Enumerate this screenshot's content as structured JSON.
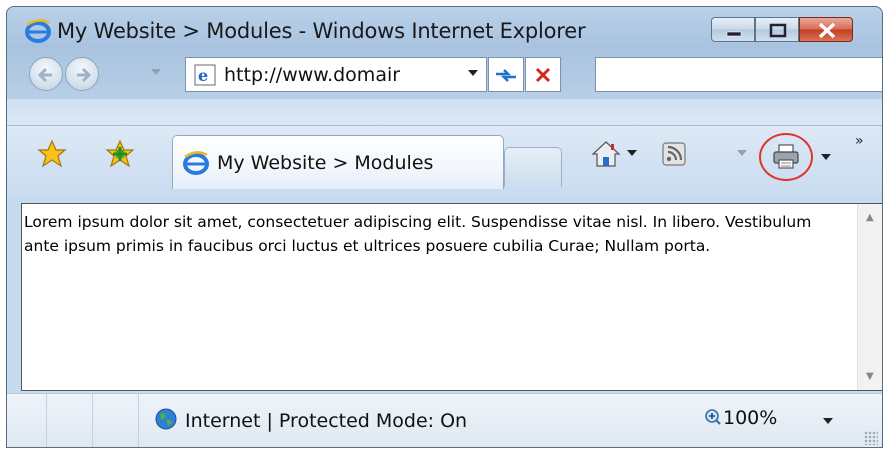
{
  "window": {
    "title": "My Website > Modules - Windows Internet Explorer"
  },
  "address_bar": {
    "url": "http://www.domair"
  },
  "tabs": [
    {
      "label": "My Website > Modules",
      "active": true
    }
  ],
  "content": {
    "text": "Lorem ipsum dolor sit amet, consectetuer adipiscing elit. Suspendisse vitae nisl. In libero. Vestibulum ante ipsum primis in faucibus orci luctus et ultrices posuere cubilia Curae; Nullam porta."
  },
  "status_bar": {
    "zone_text": "Internet | Protected Mode: On",
    "zoom": "100%"
  },
  "toolbar": {
    "overflow_glyph": "»"
  },
  "icons": {
    "title": "ie-logo-icon",
    "back": "back-arrow-icon",
    "forward": "forward-arrow-icon",
    "refresh": "refresh-icon",
    "stop": "stop-icon",
    "favorites": "favorites-star-icon",
    "add_favorites": "add-favorites-icon",
    "home": "home-icon",
    "feeds": "feeds-icon",
    "print": "print-icon",
    "zone": "globe-icon",
    "zoom": "zoom-icon"
  },
  "colors": {
    "highlight_circle": "#e3322e",
    "close_button": "#c43c24"
  }
}
